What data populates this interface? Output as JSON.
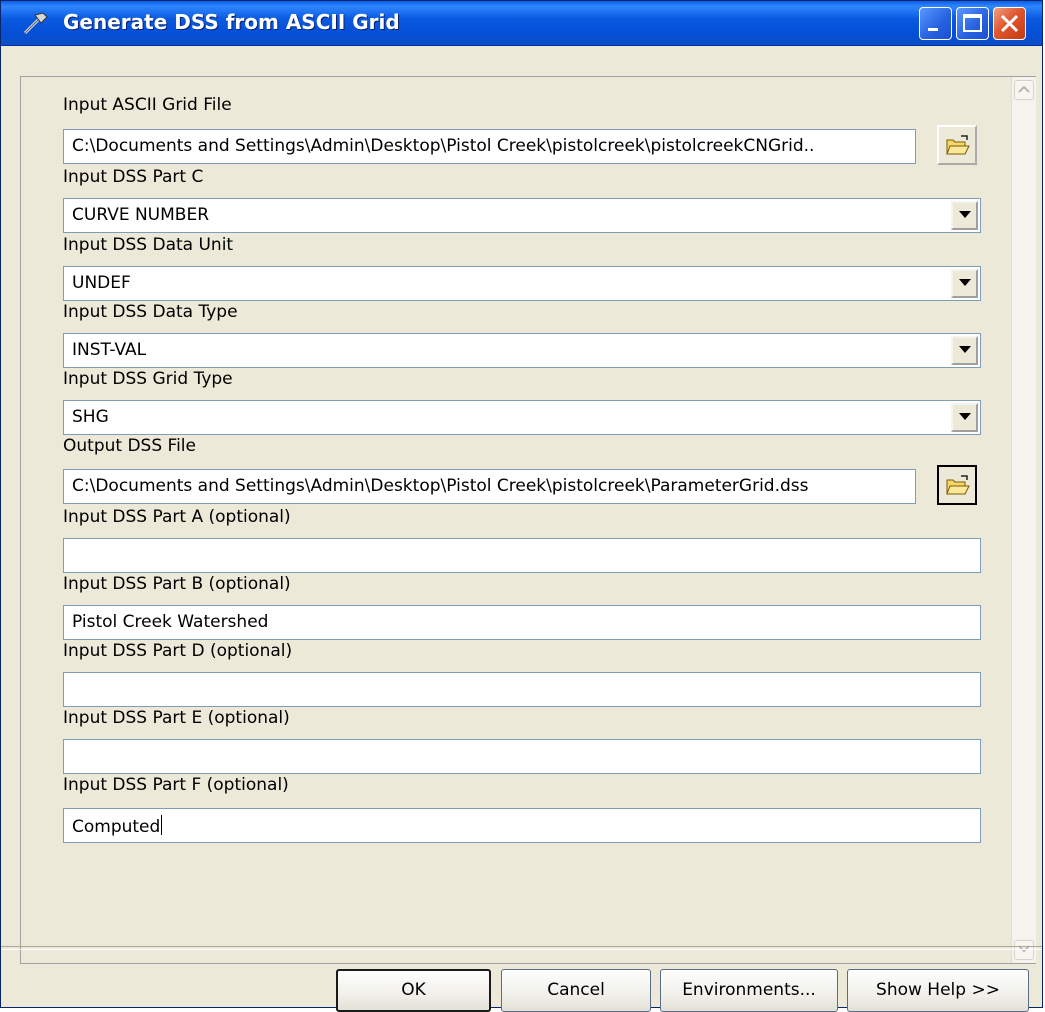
{
  "window": {
    "title": "Generate DSS from ASCII Grid"
  },
  "form": {
    "input_ascii": {
      "label": "Input ASCII Grid File",
      "value": "C:\\Documents and Settings\\Admin\\Desktop\\Pistol Creek\\pistolcreek\\pistolcreekCNGrid.."
    },
    "part_c": {
      "label": "Input DSS Part C",
      "value": "CURVE NUMBER"
    },
    "data_unit": {
      "label": "Input DSS Data Unit",
      "value": "UNDEF"
    },
    "data_type": {
      "label": "Input DSS Data Type",
      "value": "INST-VAL"
    },
    "grid_type": {
      "label": "Input DSS Grid Type",
      "value": "SHG"
    },
    "output_dss": {
      "label": "Output DSS File",
      "value": "C:\\Documents and Settings\\Admin\\Desktop\\Pistol Creek\\pistolcreek\\ParameterGrid.dss"
    },
    "part_a": {
      "label": "Input DSS Part A (optional)",
      "value": ""
    },
    "part_b": {
      "label": "Input DSS Part B (optional)",
      "value": "Pistol Creek Watershed"
    },
    "part_d": {
      "label": "Input DSS Part D (optional)",
      "value": ""
    },
    "part_e": {
      "label": "Input DSS Part E (optional)",
      "value": ""
    },
    "part_f": {
      "label": "Input DSS Part F (optional)",
      "value": "Computed"
    }
  },
  "buttons": {
    "ok": "OK",
    "cancel": "Cancel",
    "environments": "Environments...",
    "show_help": "Show Help >>"
  }
}
